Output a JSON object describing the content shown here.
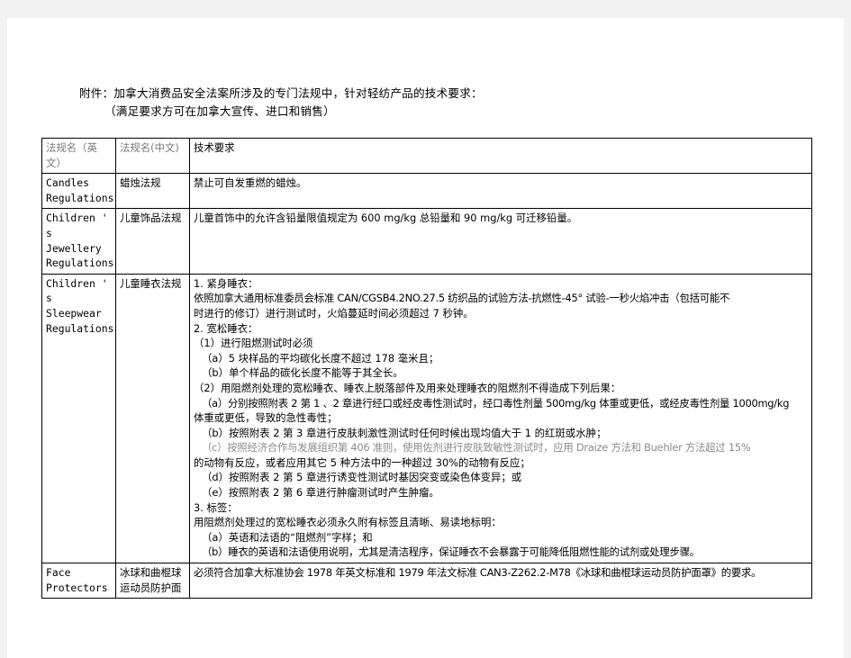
{
  "document": {
    "title_line_1": "附件：加拿大消费品安全法案所涉及的专门法规中，针对轻纺产品的技术要求：",
    "title_line_2": "（满足要求方可在加拿大宣传、进口和销售）"
  },
  "table": {
    "headers": {
      "col_en": "法规名（英文）",
      "col_cn": "法规名(中文)",
      "col_req": "技术要求"
    },
    "rows": [
      {
        "en_name": "Candles\nRegulations",
        "cn_name": "蜡烛法规",
        "requirement_lines": [
          "禁止可自发重燃的蜡烛。"
        ]
      },
      {
        "en_name": "Children ' s\nJewellery\nRegulations",
        "cn_name": "儿童饰品法规",
        "requirement_lines": [
          "儿童首饰中的允许含铅量限值规定为 600 mg/kg 总铅量和 90 mg/kg 可迁移铅量。"
        ]
      },
      {
        "en_name": "Children ' s\nSleepwear\nRegulations",
        "cn_name": "儿童睡衣法规",
        "requirement_lines": [
          "1. 紧身睡衣：",
          "依照加拿大通用标准委员会标准 CAN/CGSB4.2NO.27.5 纺织品的试验方法-抗燃性-45° 试验-一秒火焰冲击（包括可能不",
          "时进行的修订）进行测试时，火焰蔓延时间必须超过 7 秒钟。",
          "2. 宽松睡衣：",
          "（1）进行阻燃测试时必须",
          "（a）5 块样品的平均碳化长度不超过 178 毫米且；",
          "（b）单个样品的碳化长度不能等于其全长。",
          "（2）用阻燃剂处理的宽松睡衣、睡衣上脱落部件及用来处理睡衣的阻燃剂不得造成下列后果：",
          "（a）分别按照附表 2 第 1 、2 章进行经口或经皮毒性测试时，经口毒性剂量 500mg/kg 体重或更低，或经皮毒性剂量 1000mg/kg",
          "体重或更低，导致的急性毒性；",
          "（b）按照附表 2 第 3 章进行皮肤刺激性测试时任何时候出现均值大于 1 的红斑或水肿；",
          "（c）按照经济合作与发展组织第 406 准则，使用佐剂进行皮肤致敏性测试时，应用 Draize 方法和 Buehler 方法超过 15%",
          "的动物有反应，或者应用其它 5 种方法中的一种超过 30%的动物有反应；",
          "（d）按照附表 2 第 5 章进行诱变性测试时基因突变或染色体变异；或",
          "（e）按照附表 2 第 6 章进行肿瘤测试时产生肿瘤。",
          "3. 标签：",
          "用阻燃剂处理过的宽松睡衣必须永久附有标签且清晰、易读地标明：",
          "（a）英语和法语的“阻燃剂”字样；和",
          "（b）睡衣的英语和法语使用说明，尤其是清洁程序，保证睡衣不会暴露于可能降低阻燃性能的试剂或处理步骤。"
        ]
      },
      {
        "en_name": "Face\nProtectors",
        "cn_name": "冰球和曲棍球\n运动员防护面",
        "requirement_lines": [
          "必须符合加拿大标准协会 1978 年英文标准和 1979 年法文标准 CAN3-Z262.2-M78《冰球和曲棍球运动员防护面罩》的要求。"
        ]
      }
    ]
  }
}
